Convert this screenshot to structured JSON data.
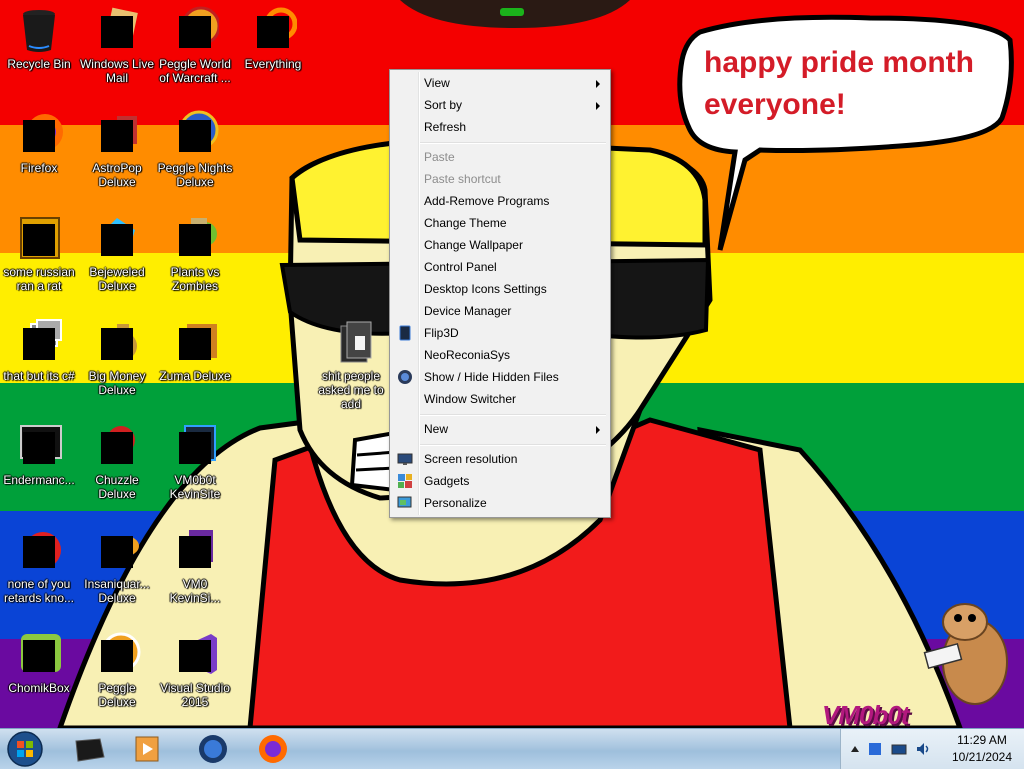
{
  "colors": {
    "red": "#f40000",
    "orange": "#ff8c00",
    "yellow": "#ffee00",
    "green": "#00a03a",
    "blue": "#0a44d6",
    "purple": "#6a0aa0",
    "menu_bg": "#f1f1f1",
    "menu_disabled": "#8d8d8d",
    "bubble_text": "#d41c28"
  },
  "desktop": {
    "speech_bubble_line1": "happy pride month",
    "speech_bubble_line2": "everyone!",
    "brand_mark": "VM0b0t",
    "icons": [
      {
        "label": "Recycle Bin",
        "icon": "recycle-bin-icon"
      },
      {
        "label": "Windows Live Mail",
        "icon": "mail-icon"
      },
      {
        "label": "Peggle World of Warcraft ...",
        "icon": "peggle-icon"
      },
      {
        "label": "Everything",
        "icon": "search-icon"
      },
      {
        "label": "Firefox",
        "icon": "firefox-icon"
      },
      {
        "label": "AstroPop Deluxe",
        "icon": "game-icon"
      },
      {
        "label": "Peggle Nights Deluxe",
        "icon": "peggle-icon"
      },
      {
        "label": "some russian ran a rat",
        "icon": "shortcut-icon"
      },
      {
        "label": "Bejeweled Deluxe",
        "icon": "gem-icon"
      },
      {
        "label": "Plants vs Zombies",
        "icon": "plant-icon"
      },
      {
        "label": "that but its c#",
        "icon": "windows-stack-icon"
      },
      {
        "label": "Big Money Deluxe",
        "icon": "money-bag-icon"
      },
      {
        "label": "Zuma Deluxe",
        "icon": "zuma-icon"
      },
      {
        "label": "Endermanc...",
        "icon": "terminal-icon"
      },
      {
        "label": "Chuzzle Deluxe",
        "icon": "chuzzle-icon"
      },
      {
        "label": "VM0b0t KevinSite",
        "icon": "site-icon"
      },
      {
        "label": "none of you retards kno...",
        "icon": "chrome-icon"
      },
      {
        "label": "Insaniquar... Deluxe",
        "icon": "fish-icon"
      },
      {
        "label": "VM0 KevinSi...",
        "icon": "file-icon"
      },
      {
        "label": "ChomikBox",
        "icon": "chomikbox-icon"
      },
      {
        "label": "Peggle Deluxe",
        "icon": "peggle-icon"
      },
      {
        "label": "Visual Studio 2015",
        "icon": "visual-studio-icon"
      },
      {
        "label": "shit people asked me to add",
        "icon": "folder-icon"
      }
    ]
  },
  "context_menu": {
    "items": [
      {
        "label": "View",
        "submenu": true
      },
      {
        "label": "Sort by",
        "submenu": true
      },
      {
        "label": "Refresh"
      },
      {
        "label": "Paste",
        "disabled": true
      },
      {
        "label": "Paste shortcut",
        "disabled": true
      },
      {
        "label": "Add-Remove Programs"
      },
      {
        "label": "Change Theme"
      },
      {
        "label": "Change Wallpaper"
      },
      {
        "label": "Control Panel"
      },
      {
        "label": "Desktop Icons Settings"
      },
      {
        "label": "Device Manager"
      },
      {
        "label": "Flip3D",
        "icon": "flip3d-icon"
      },
      {
        "label": "NeoReconiaSys"
      },
      {
        "label": "Show / Hide Hidden Files",
        "icon": "globe-icon"
      },
      {
        "label": "Window Switcher"
      },
      {
        "label": "New",
        "submenu": true
      },
      {
        "label": "Screen resolution",
        "icon": "monitor-icon"
      },
      {
        "label": "Gadgets",
        "icon": "gadgets-icon"
      },
      {
        "label": "Personalize",
        "icon": "personalize-icon"
      }
    ]
  },
  "taskbar": {
    "pinned": [
      {
        "icon": "black-box-icon"
      },
      {
        "icon": "media-player-icon"
      },
      {
        "icon": "globe-icon"
      },
      {
        "icon": "firefox-icon"
      }
    ],
    "clock_time": "11:29 AM",
    "clock_date": "10/21/2024"
  }
}
